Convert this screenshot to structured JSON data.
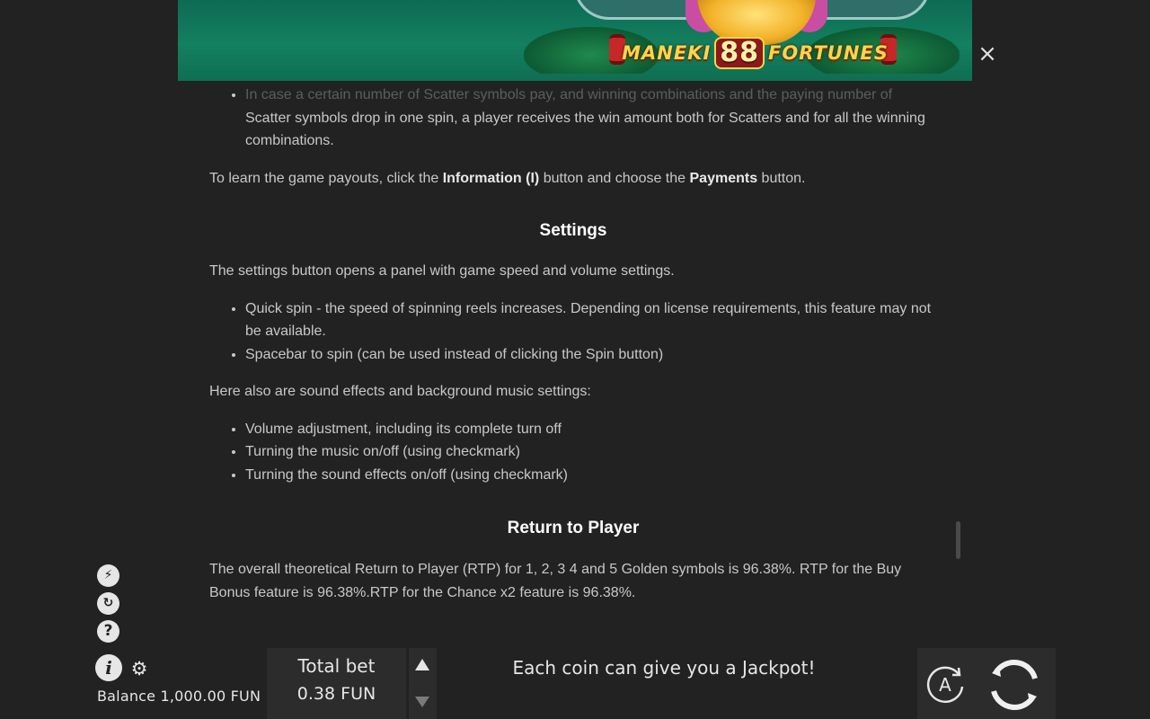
{
  "header": {
    "logo_word_1": "MANEKI",
    "logo_number": "88",
    "logo_word_2": "FORTUNES",
    "close_glyph": "×"
  },
  "content": {
    "faded_bullet": "In case a certain number of Scatter symbols pay, and winning combinations and the paying number of",
    "bullet_cont": "Scatter symbols drop in one spin, a player receives the win amount both for Scatters and for all the winning combinations.",
    "payouts_text_1": "To learn the game payouts, click the ",
    "payouts_bold_1": "Information (I)",
    "payouts_text_2": " button and choose the ",
    "payouts_bold_2": "Payments",
    "payouts_text_3": " button.",
    "settings_heading": "Settings",
    "settings_intro": "The settings button opens a panel with game speed and volume settings.",
    "settings_items": [
      "Quick spin - the speed of spinning reels increases. Depending on license requirements, this feature may not be available.",
      "Spacebar to spin (can be used instead of clicking the Spin button)"
    ],
    "sound_intro": "Here also are sound effects and background music settings:",
    "sound_items": [
      "Volume adjustment, including its complete turn off",
      "Turning the music on/off (using checkmark)",
      "Turning the sound effects on/off (using checkmark)"
    ],
    "rtp_heading": "Return to Player",
    "rtp_text": "The overall theoretical Return to Player (RTP) for 1, 2, 3 4 and 5 Golden symbols is 96.38%. RTP for the Buy Bonus feature is 96.38%.RTP for the Chance x2 feature is 96.38%."
  },
  "controls": {
    "turbo_glyph": "⚡",
    "autoplay_glyph": "↻",
    "help_glyph": "?",
    "info_glyph": "i",
    "settings_glyph": "⚙",
    "balance": "Balance 1,000.00 FUN",
    "total_bet_label": "Total bet",
    "total_bet_value": "0.38 FUN",
    "promo": "Each coin can give you a Jackpot!",
    "auto_label": "A"
  },
  "colors": {
    "background": "#222222",
    "banner": "#13805f",
    "text": "#c8c8c8",
    "heading": "#ffffff",
    "panel": "#2c2c2c"
  }
}
